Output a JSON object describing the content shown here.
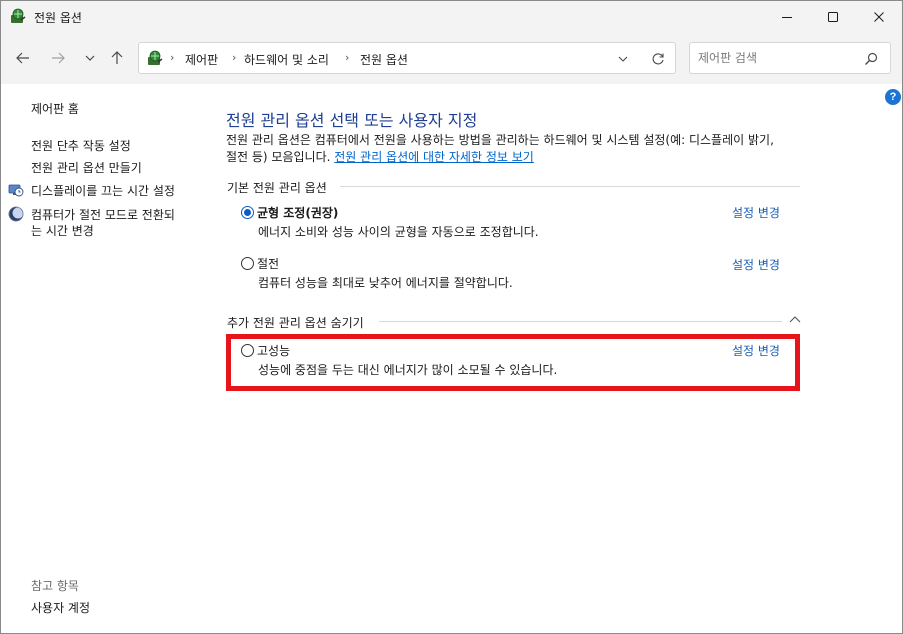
{
  "window": {
    "title": "전원 옵션",
    "controls": {
      "minimize": "minimize-icon",
      "maximize": "maximize-icon",
      "close": "close-icon"
    }
  },
  "address": {
    "breadcrumbs": [
      "제어판",
      "하드웨어 및 소리",
      "전원 옵션"
    ],
    "search_placeholder": "제어판 검색"
  },
  "sidebar": {
    "home": "제어판 홈",
    "items": [
      {
        "label": "전원 단추 작동 설정",
        "icon": ""
      },
      {
        "label": "전원 관리 옵션 만들기",
        "icon": ""
      },
      {
        "label": "디스플레이를 끄는 시간 설정",
        "icon": "display-clock-icon"
      },
      {
        "label": "컴퓨터가 절전 모드로 전환되는 시간 변경",
        "label_line1": "컴퓨터가 절전 모드로 전환되",
        "label_line2": "는 시간 변경",
        "icon": "moon-icon"
      }
    ],
    "see_also": "참고 항목",
    "user_accounts": "사용자 계정"
  },
  "main": {
    "title": "전원 관리 옵션 선택 또는 사용자 지정",
    "description_line1": "전원 관리 옵션은 컴퓨터에서 전원을 사용하는 방법을 관리하는 하드웨어 및 시스템 설정(예: 디스플레이 밝기,",
    "description_line2_prefix": "절전 등) 모음입니다. ",
    "description_link": "전원 관리 옵션에 대한 자세한 정보 보기",
    "preferred_group": "기본 전원 관리 옵션",
    "additional_group": "추가 전원 관리 옵션 숨기기",
    "plans": [
      {
        "name": "균형 조정(권장)",
        "description": "에너지 소비와 성능 사이의 균형을 자동으로 조정합니다.",
        "link": "설정 변경",
        "selected": true
      },
      {
        "name": "절전",
        "description": "컴퓨터 성능을 최대로 낮추어 에너지를 절약합니다.",
        "link": "설정 변경",
        "selected": false
      },
      {
        "name": "고성능",
        "description": "성능에 중점을 두는 대신 에너지가 많이 소모될 수 있습니다.",
        "link": "설정 변경",
        "selected": false
      }
    ]
  },
  "colors": {
    "title": "#1e3f92",
    "link": "#1a5fb4",
    "highlight": "#e8141c",
    "radio_selected": "#0a5bc7"
  }
}
